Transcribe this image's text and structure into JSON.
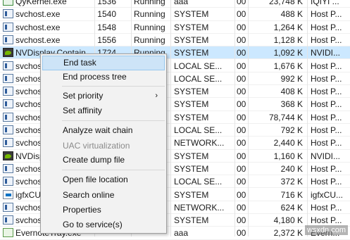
{
  "rows": [
    {
      "icon": "qy-icon",
      "name": "QyKernel.exe",
      "pid": "1536",
      "status": "Running",
      "user": "aaa",
      "cpu": "00",
      "mem": "23,748 K",
      "desc": "IQIYI ..."
    },
    {
      "icon": "service-icon",
      "name": "svchost.exe",
      "pid": "1540",
      "status": "Running",
      "user": "SYSTEM",
      "cpu": "00",
      "mem": "488 K",
      "desc": "Host P..."
    },
    {
      "icon": "service-icon",
      "name": "svchost.exe",
      "pid": "1548",
      "status": "Running",
      "user": "SYSTEM",
      "cpu": "00",
      "mem": "1,264 K",
      "desc": "Host P..."
    },
    {
      "icon": "service-icon",
      "name": "svchost.exe",
      "pid": "1556",
      "status": "Running",
      "user": "SYSTEM",
      "cpu": "00",
      "mem": "1,128 K",
      "desc": "Host P..."
    },
    {
      "icon": "nvidia-icon",
      "name": "NVDisplay.Contain...",
      "pid": "1724",
      "status": "Running",
      "user": "SYSTEM",
      "cpu": "00",
      "mem": "1,092 K",
      "desc": "NVIDI...",
      "selected": true
    },
    {
      "icon": "service-icon",
      "name": "svchost.exe",
      "pid": "",
      "status": "",
      "user": "LOCAL SE...",
      "cpu": "00",
      "mem": "1,676 K",
      "desc": "Host P..."
    },
    {
      "icon": "service-icon",
      "name": "svchost.exe",
      "pid": "",
      "status": "",
      "user": "LOCAL SE...",
      "cpu": "00",
      "mem": "992 K",
      "desc": "Host P..."
    },
    {
      "icon": "service-icon",
      "name": "svchost.exe",
      "pid": "",
      "status": "",
      "user": "SYSTEM",
      "cpu": "00",
      "mem": "408 K",
      "desc": "Host P..."
    },
    {
      "icon": "service-icon",
      "name": "svchost.exe",
      "pid": "",
      "status": "",
      "user": "SYSTEM",
      "cpu": "00",
      "mem": "368 K",
      "desc": "Host P..."
    },
    {
      "icon": "service-icon",
      "name": "svchost.exe",
      "pid": "",
      "status": "",
      "user": "SYSTEM",
      "cpu": "00",
      "mem": "78,744 K",
      "desc": "Host P..."
    },
    {
      "icon": "service-icon",
      "name": "svchost.exe",
      "pid": "",
      "status": "",
      "user": "LOCAL SE...",
      "cpu": "00",
      "mem": "792 K",
      "desc": "Host P..."
    },
    {
      "icon": "service-icon",
      "name": "svchost.exe",
      "pid": "",
      "status": "",
      "user": "NETWORK...",
      "cpu": "00",
      "mem": "2,440 K",
      "desc": "Host P..."
    },
    {
      "icon": "nvidia-icon",
      "name": "NVDisplay.Contain...",
      "pid": "",
      "status": "",
      "user": "SYSTEM",
      "cpu": "00",
      "mem": "1,160 K",
      "desc": "NVIDI..."
    },
    {
      "icon": "service-icon",
      "name": "svchost.exe",
      "pid": "",
      "status": "",
      "user": "SYSTEM",
      "cpu": "00",
      "mem": "240 K",
      "desc": "Host P..."
    },
    {
      "icon": "service-icon",
      "name": "svchost.exe",
      "pid": "",
      "status": "",
      "user": "LOCAL SE...",
      "cpu": "00",
      "mem": "372 K",
      "desc": "Host P..."
    },
    {
      "icon": "igfx-icon",
      "name": "igfxCUIService.exe",
      "pid": "",
      "status": "",
      "user": "SYSTEM",
      "cpu": "00",
      "mem": "716 K",
      "desc": "igfxCU..."
    },
    {
      "icon": "service-icon",
      "name": "svchost.exe",
      "pid": "",
      "status": "",
      "user": "NETWORK...",
      "cpu": "00",
      "mem": "624 K",
      "desc": "Host P..."
    },
    {
      "icon": "service-icon",
      "name": "svchost.exe",
      "pid": "",
      "status": "",
      "user": "SYSTEM",
      "cpu": "00",
      "mem": "4,180 K",
      "desc": "Host P..."
    },
    {
      "icon": "evernote-icon",
      "name": "EvernoteTray.exe",
      "pid": "",
      "status": "",
      "user": "aaa",
      "cpu": "00",
      "mem": "2,372 K",
      "desc": "Evern..."
    }
  ],
  "context_menu": {
    "items": [
      {
        "label": "End task",
        "highlighted": true
      },
      {
        "label": "End process tree"
      },
      {
        "label": "Set priority",
        "submenu": true
      },
      {
        "label": "Set affinity"
      },
      {
        "label": "Analyze wait chain"
      },
      {
        "label": "UAC virtualization",
        "disabled": true
      },
      {
        "label": "Create dump file"
      },
      {
        "label": "Open file location"
      },
      {
        "label": "Search online"
      },
      {
        "label": "Properties"
      },
      {
        "label": "Go to service(s)"
      }
    ],
    "submenu_arrow": "›"
  },
  "watermark": "wsxdn.com"
}
